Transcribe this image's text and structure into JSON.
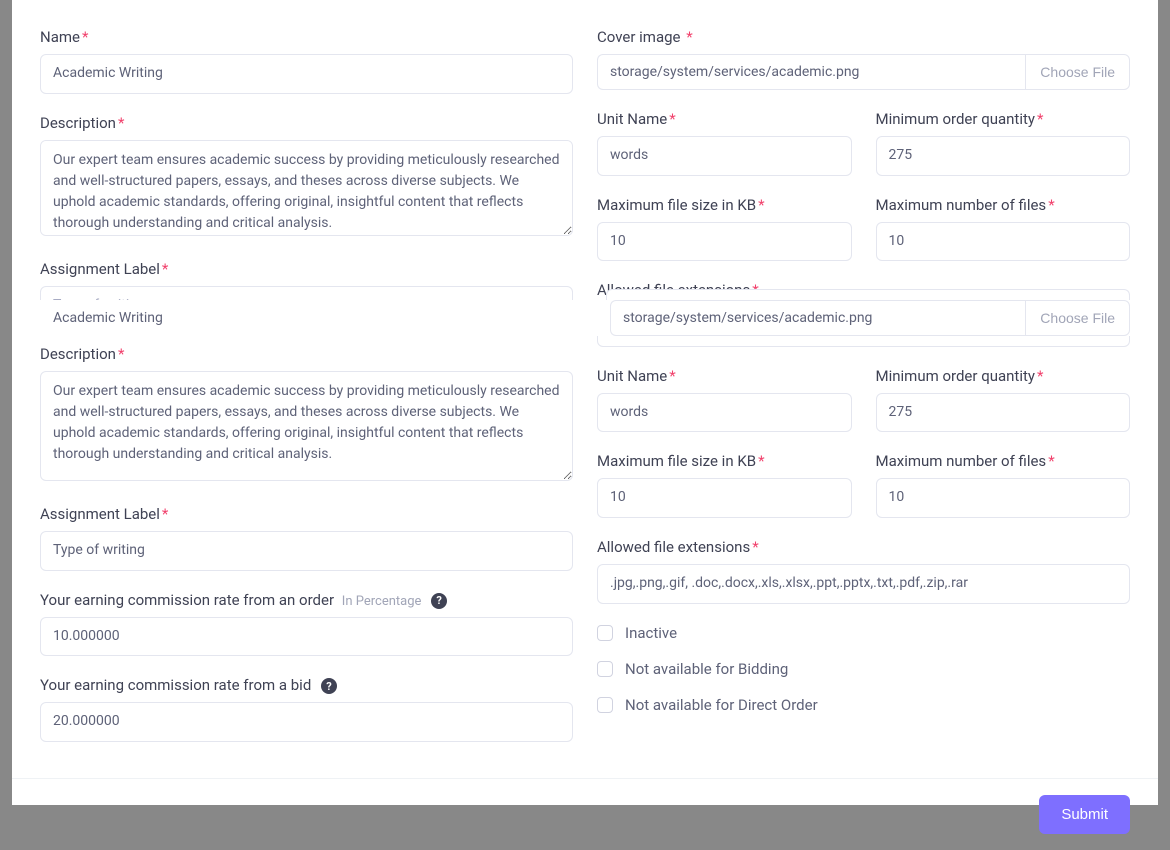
{
  "left": {
    "name": {
      "label": "Name",
      "value": "Academic Writing"
    },
    "description1": {
      "label": "Description",
      "value": "Our expert team ensures academic success by providing meticulously researched and well-structured papers, essays, and theses across diverse subjects. We uphold academic standards, offering original, insightful content that reflects thorough understanding and critical analysis."
    },
    "assignment_label1": {
      "label": "Assignment Label",
      "placeholder": "Type of writing"
    },
    "overlay_name_value": "Academic Writing",
    "description2": {
      "label": "Description",
      "value": "Our expert team ensures academic success by providing meticulously researched and well-structured papers, essays, and theses across diverse subjects. We uphold academic standards, offering original, insightful content that reflects thorough understanding and critical analysis."
    },
    "assignment_label2": {
      "label": "Assignment Label",
      "value": "Type of writing"
    },
    "commission_order": {
      "label": "Your earning commission rate from an order",
      "hint": "In Percentage",
      "value": "10.000000"
    },
    "commission_bid": {
      "label": "Your earning commission rate from a bid",
      "value": "20.000000"
    }
  },
  "right": {
    "cover_image": {
      "label": "Cover image",
      "path": "storage/system/services/academic.png",
      "choose": "Choose File"
    },
    "unit_name1": {
      "label": "Unit Name",
      "value": "words"
    },
    "min_order1": {
      "label": "Minimum order quantity",
      "value": "275"
    },
    "max_file_size1": {
      "label": "Maximum file size in KB",
      "value": "10"
    },
    "max_files1": {
      "label": "Maximum number of files",
      "value": "10"
    },
    "allowed_ext_scrap": {
      "label": "Allowed file extensions",
      "partial": ".jpg,.png,.gif, .doc,.docx,.xls,.xlsx,.ppt,.pptx,.txt,.pdf,.zip,.rar"
    },
    "overlay_file": {
      "path": "storage/system/services/academic.png",
      "choose": "Choose File"
    },
    "unit_name2": {
      "label": "Unit Name",
      "value": "words"
    },
    "min_order2": {
      "label": "Minimum order quantity",
      "value": "275"
    },
    "max_file_size2": {
      "label": "Maximum file size in KB",
      "value": "10"
    },
    "max_files2": {
      "label": "Maximum number of files",
      "value": "10"
    },
    "allowed_ext": {
      "label": "Allowed file extensions",
      "value": ".jpg,.png,.gif, .doc,.docx,.xls,.xlsx,.ppt,.pptx,.txt,.pdf,.zip,.rar"
    },
    "inactive": {
      "label": "Inactive"
    },
    "no_bidding": {
      "label": "Not available for Bidding"
    },
    "no_direct": {
      "label": "Not available for Direct Order"
    }
  },
  "submit_label": "Submit"
}
